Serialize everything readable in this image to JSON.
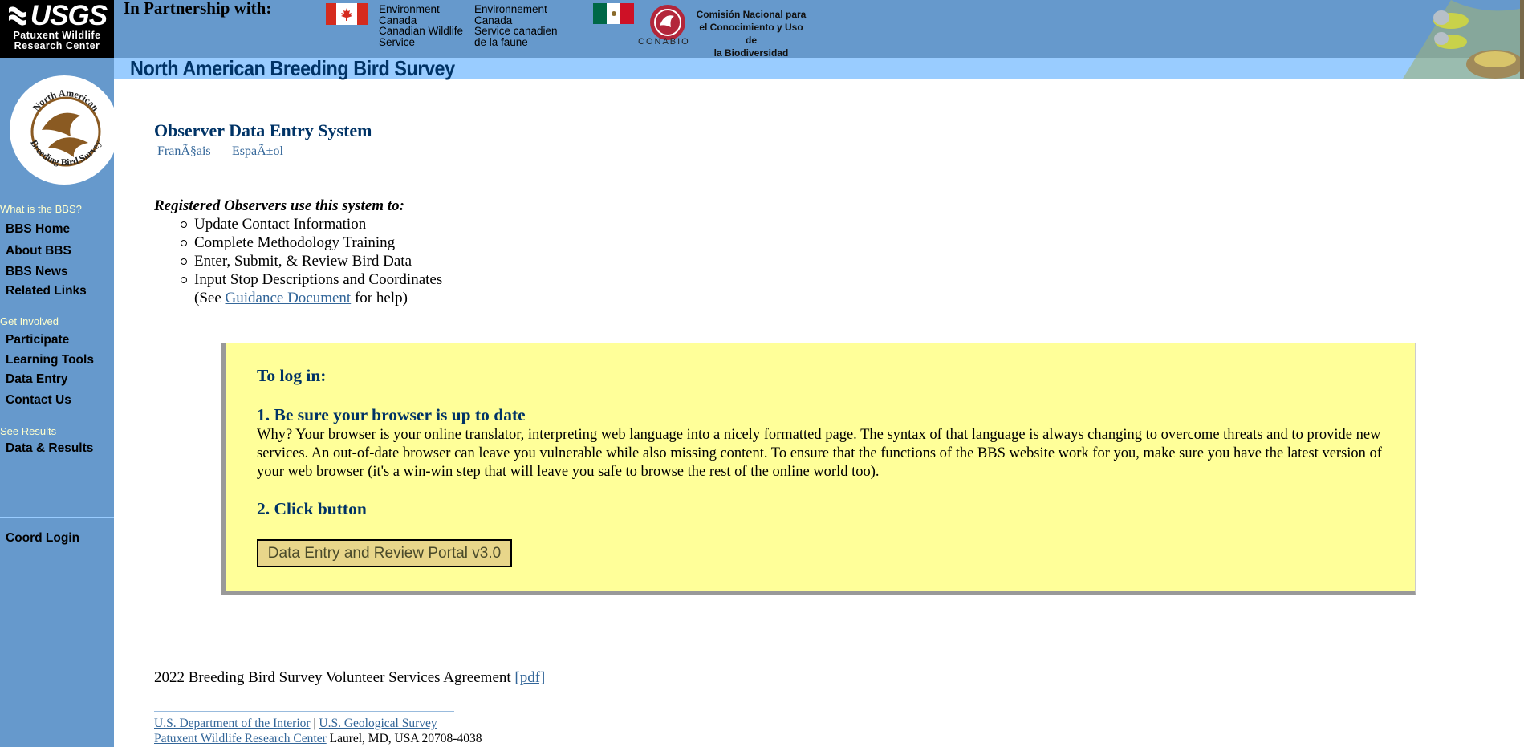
{
  "header": {
    "usgs_word": "USGS",
    "usgs_sub_line1": "Patuxent Wildlife",
    "usgs_sub_line2": "Research Center",
    "partnership_label": "In Partnership with:",
    "ec_en_line1": "Environment",
    "ec_en_line2": "Canada",
    "ec_en_line3": "Canadian Wildlife",
    "ec_en_line4": "Service",
    "ec_fr_line1": "Environnement",
    "ec_fr_line2": "Canada",
    "ec_fr_line3": "Service canadien",
    "ec_fr_line4": "de la faune",
    "conabio_name": "CONABIO",
    "conabio_line1": "Comisión Nacional para",
    "conabio_line2": "el Conocimiento y Uso de",
    "conabio_line3": "la Biodiversidad",
    "survey_title": "North American Breeding Bird Survey"
  },
  "sidebar": {
    "seal_text_top": "North American",
    "seal_text_bottom": "Breeding Bird Survey",
    "section_what": "What is the BBS?",
    "bbs_home": "BBS Home",
    "about_bbs": "About BBS",
    "bbs_news": "BBS News",
    "related_links": "Related Links",
    "section_involved": "Get Involved",
    "participate": "Participate",
    "learning_tools": "Learning Tools",
    "data_entry": "Data Entry",
    "contact_us": "Contact Us",
    "section_results": "See Results",
    "data_results": "Data & Results",
    "coord_login": "Coord Login"
  },
  "main": {
    "page_title": "Observer Data Entry System",
    "lang_fr": "FranÃ§ais",
    "lang_es": "EspaÃ±ol",
    "intro": "Registered Observers use this system to:",
    "tasks": [
      "Update Contact Information",
      "Complete Methodology Training",
      "Enter, Submit, & Review Bird Data",
      "Input Stop Descriptions and Coordinates"
    ],
    "help_prefix": "(See ",
    "help_link": "Guidance Document",
    "help_suffix": " for help)"
  },
  "login_box": {
    "heading": "To log in:",
    "step1_heading": "1. Be sure your browser is up to date",
    "step1_body": "Why? Your browser is your online translator, interpreting web language into a nicely formatted page. The syntax of that language is always changing to overcome threats and to provide new services. An out-of-date browser can leave you vulnerable while also missing content. To ensure that the functions of the BBS website work for you, make sure you have the latest version of your web browser (it's a win-win step that will leave you safe to browse the rest of the online world too).",
    "step2_heading": "2. Click button",
    "portal_button": "Data Entry and Review Portal v3.0"
  },
  "footer": {
    "agreement_text": "2022 Breeding Bird Survey Volunteer Services Agreement ",
    "agreement_link": "[pdf]",
    "doi_link": "U.S. Department of the Interior",
    "separator": " | ",
    "usgs_link": "U.S. Geological Survey",
    "pwrc_link": "Patuxent Wildlife Research Center",
    "address": " Laurel, MD, USA 20708-4038"
  },
  "colors": {
    "header_blue": "#6699cc",
    "title_bar": "#99ccff",
    "title_text": "#003366",
    "login_box_bg": "#ffff99",
    "link": "#336699"
  }
}
